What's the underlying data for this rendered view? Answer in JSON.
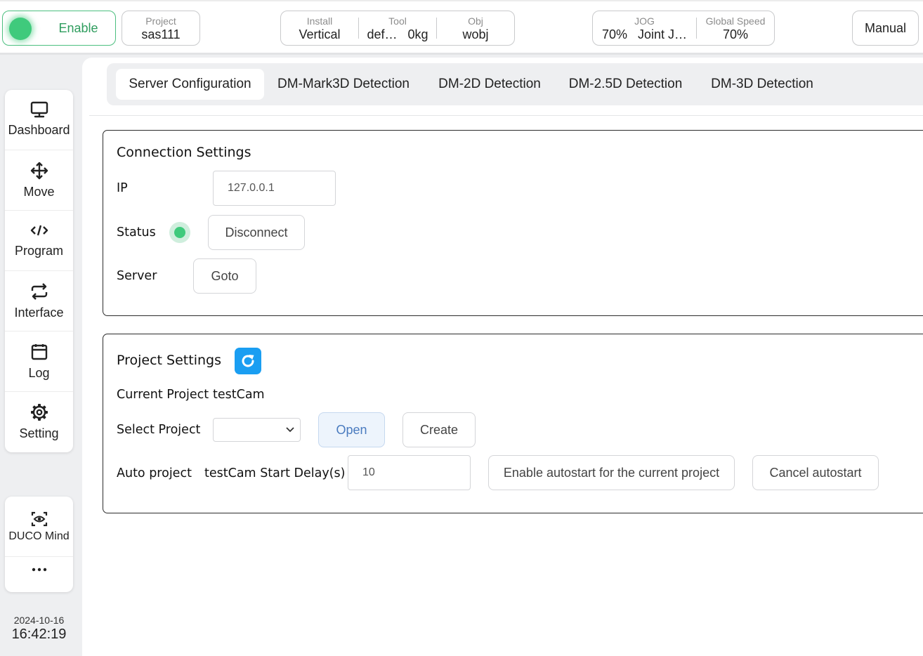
{
  "topbar": {
    "enable_label": "Enable",
    "project": {
      "title": "Project",
      "value": "sas111"
    },
    "install": {
      "title": "Install",
      "value": "Vertical"
    },
    "tool": {
      "title": "Tool",
      "name": "def…",
      "load": "0kg"
    },
    "obj": {
      "title": "Obj",
      "value": "wobj"
    },
    "jog": {
      "title": "JOG",
      "percent": "70%",
      "mode": "Joint J…"
    },
    "global_speed": {
      "title": "Global Speed",
      "value": "70%"
    },
    "mode_label": "Manual"
  },
  "sidebar": {
    "items": [
      {
        "label": "Dashboard",
        "icon": "monitor-icon"
      },
      {
        "label": "Move",
        "icon": "move-arrows-icon"
      },
      {
        "label": "Program",
        "icon": "code-icon"
      },
      {
        "label": "Interface",
        "icon": "swap-arrows-icon"
      },
      {
        "label": "Log",
        "icon": "calendar-icon"
      },
      {
        "label": "Setting",
        "icon": "gear-icon"
      }
    ],
    "extra": [
      {
        "label": "DUCO Mind",
        "icon": "eye-scan-icon"
      },
      {
        "label": "...",
        "icon": "more-dots-icon"
      }
    ],
    "date": "2024-10-16",
    "time": "16:42:19"
  },
  "tabs": [
    {
      "label": "Server Configuration",
      "active": true
    },
    {
      "label": "DM-Mark3D Detection",
      "active": false
    },
    {
      "label": "DM-2D Detection",
      "active": false
    },
    {
      "label": "DM-2.5D Detection",
      "active": false
    },
    {
      "label": "DM-3D Detection",
      "active": false
    }
  ],
  "connection": {
    "title": "Connection Settings",
    "ip_label": "IP",
    "ip_value": "127.0.0.1",
    "status_label": "Status",
    "status_color": "#3fca7c",
    "disconnect_label": "Disconnect",
    "server_label": "Server",
    "goto_label": "Goto"
  },
  "project_settings": {
    "title": "Project Settings",
    "current_project_label": "Current Project",
    "current_project_value": "testCam",
    "select_project_label": "Select Project",
    "select_value": "",
    "open_label": "Open",
    "create_label": "Create",
    "auto_project_label": "Auto project",
    "auto_project_value": "testCam",
    "start_delay_label": "Start Delay(s)",
    "start_delay_value": "10",
    "enable_autostart_label": "Enable autostart for the current project",
    "cancel_autostart_label": "Cancel autostart"
  },
  "colors": {
    "accent": "#1a9ef2",
    "enable_green": "#3fca7c"
  }
}
